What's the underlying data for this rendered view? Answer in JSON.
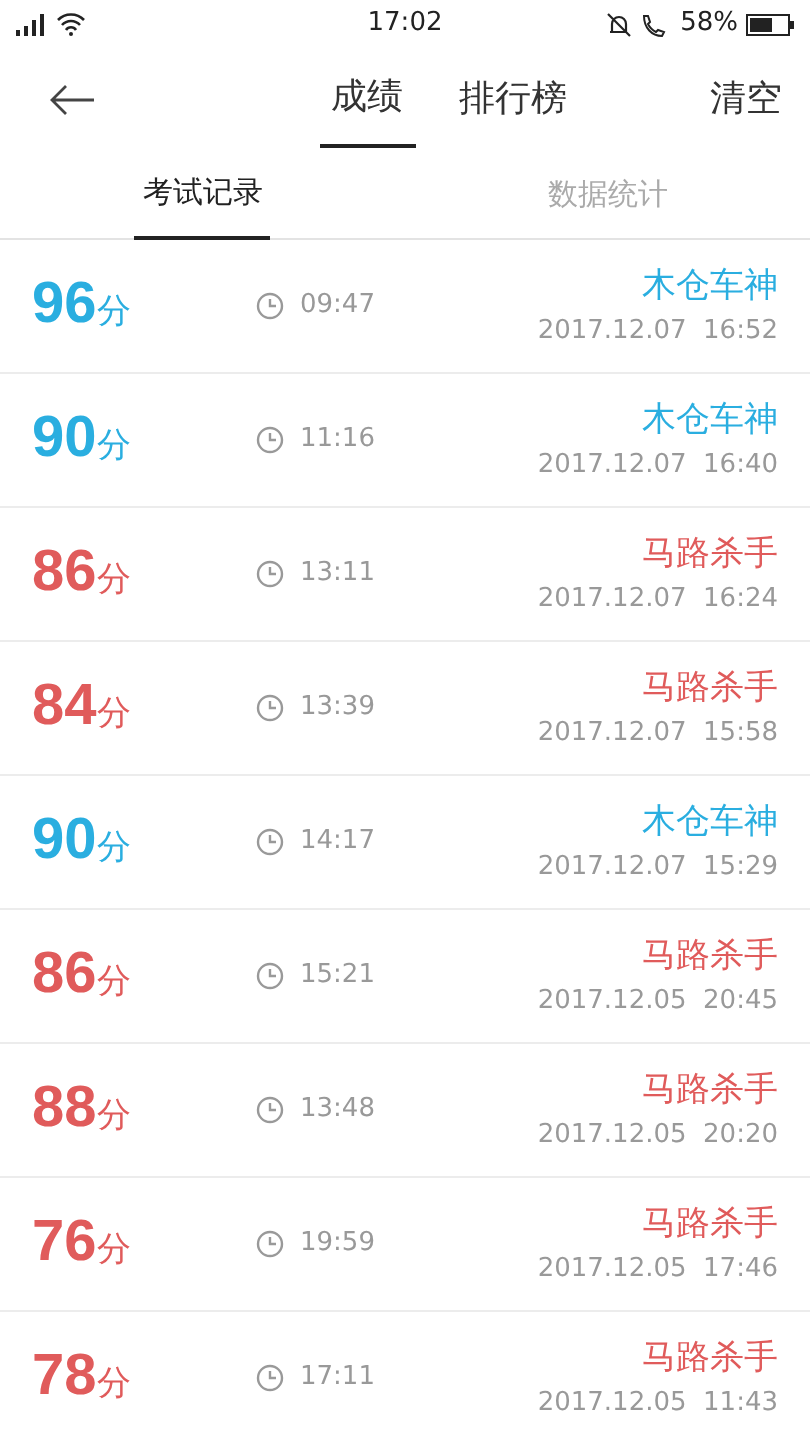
{
  "status_bar": {
    "time": "17:02",
    "battery": "58%"
  },
  "header": {
    "tabs": [
      {
        "label": "成绩",
        "selected": true
      },
      {
        "label": "排行榜",
        "selected": false
      }
    ],
    "action": "清空"
  },
  "subtabs": [
    {
      "label": "考试记录",
      "selected": true
    },
    {
      "label": "数据统计",
      "selected": false
    }
  ],
  "records": [
    {
      "score": "96",
      "unit": "分",
      "duration": "09:47",
      "title": "木仓车神",
      "date": "2017.12.07  16:52",
      "color": "#2aaee0"
    },
    {
      "score": "90",
      "unit": "分",
      "duration": "11:16",
      "title": "木仓车神",
      "date": "2017.12.07  16:40",
      "color": "#2aaee0"
    },
    {
      "score": "86",
      "unit": "分",
      "duration": "13:11",
      "title": "马路杀手",
      "date": "2017.12.07  16:24",
      "color": "#e05b5b"
    },
    {
      "score": "84",
      "unit": "分",
      "duration": "13:39",
      "title": "马路杀手",
      "date": "2017.12.07  15:58",
      "color": "#e05b5b"
    },
    {
      "score": "90",
      "unit": "分",
      "duration": "14:17",
      "title": "木仓车神",
      "date": "2017.12.07  15:29",
      "color": "#2aaee0"
    },
    {
      "score": "86",
      "unit": "分",
      "duration": "15:21",
      "title": "马路杀手",
      "date": "2017.12.05  20:45",
      "color": "#e05b5b"
    },
    {
      "score": "88",
      "unit": "分",
      "duration": "13:48",
      "title": "马路杀手",
      "date": "2017.12.05  20:20",
      "color": "#e05b5b"
    },
    {
      "score": "76",
      "unit": "分",
      "duration": "19:59",
      "title": "马路杀手",
      "date": "2017.12.05  17:46",
      "color": "#e05b5b"
    },
    {
      "score": "78",
      "unit": "分",
      "duration": "17:11",
      "title": "马路杀手",
      "date": "2017.12.05  11:43",
      "color": "#e05b5b"
    }
  ]
}
